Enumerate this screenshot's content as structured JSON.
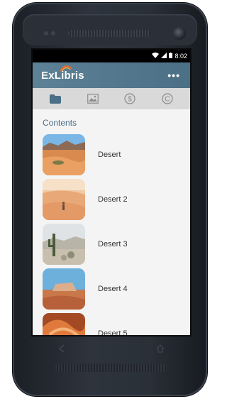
{
  "statusbar": {
    "time": "8:02",
    "wifi_icon": "wifi-icon",
    "signal_icon": "signal-icon",
    "battery_icon": "battery-icon"
  },
  "appbar": {
    "logo_text": "ExLibris",
    "menu_label": "•••"
  },
  "tabs": [
    {
      "icon": "folder-icon",
      "active": true
    },
    {
      "icon": "image-icon",
      "active": false
    },
    {
      "icon": "dollar-circle-icon",
      "active": false
    },
    {
      "icon": "copyright-icon",
      "active": false
    }
  ],
  "contents": {
    "title": "Contents",
    "items": [
      {
        "label": "Desert",
        "thumb": "desert-dunes-sky"
      },
      {
        "label": "Desert 2",
        "thumb": "desert-sand-person"
      },
      {
        "label": "Desert 3",
        "thumb": "desert-cactus"
      },
      {
        "label": "Desert 4",
        "thumb": "desert-mesa"
      },
      {
        "label": "Desert 5",
        "thumb": "desert-canyon"
      }
    ]
  },
  "nav": {
    "back_icon": "back-icon",
    "home_icon": "home-icon"
  },
  "colors": {
    "appbar": "#5d8296",
    "accent_text": "#4a6f86",
    "tabbar": "#d9d9d9"
  }
}
